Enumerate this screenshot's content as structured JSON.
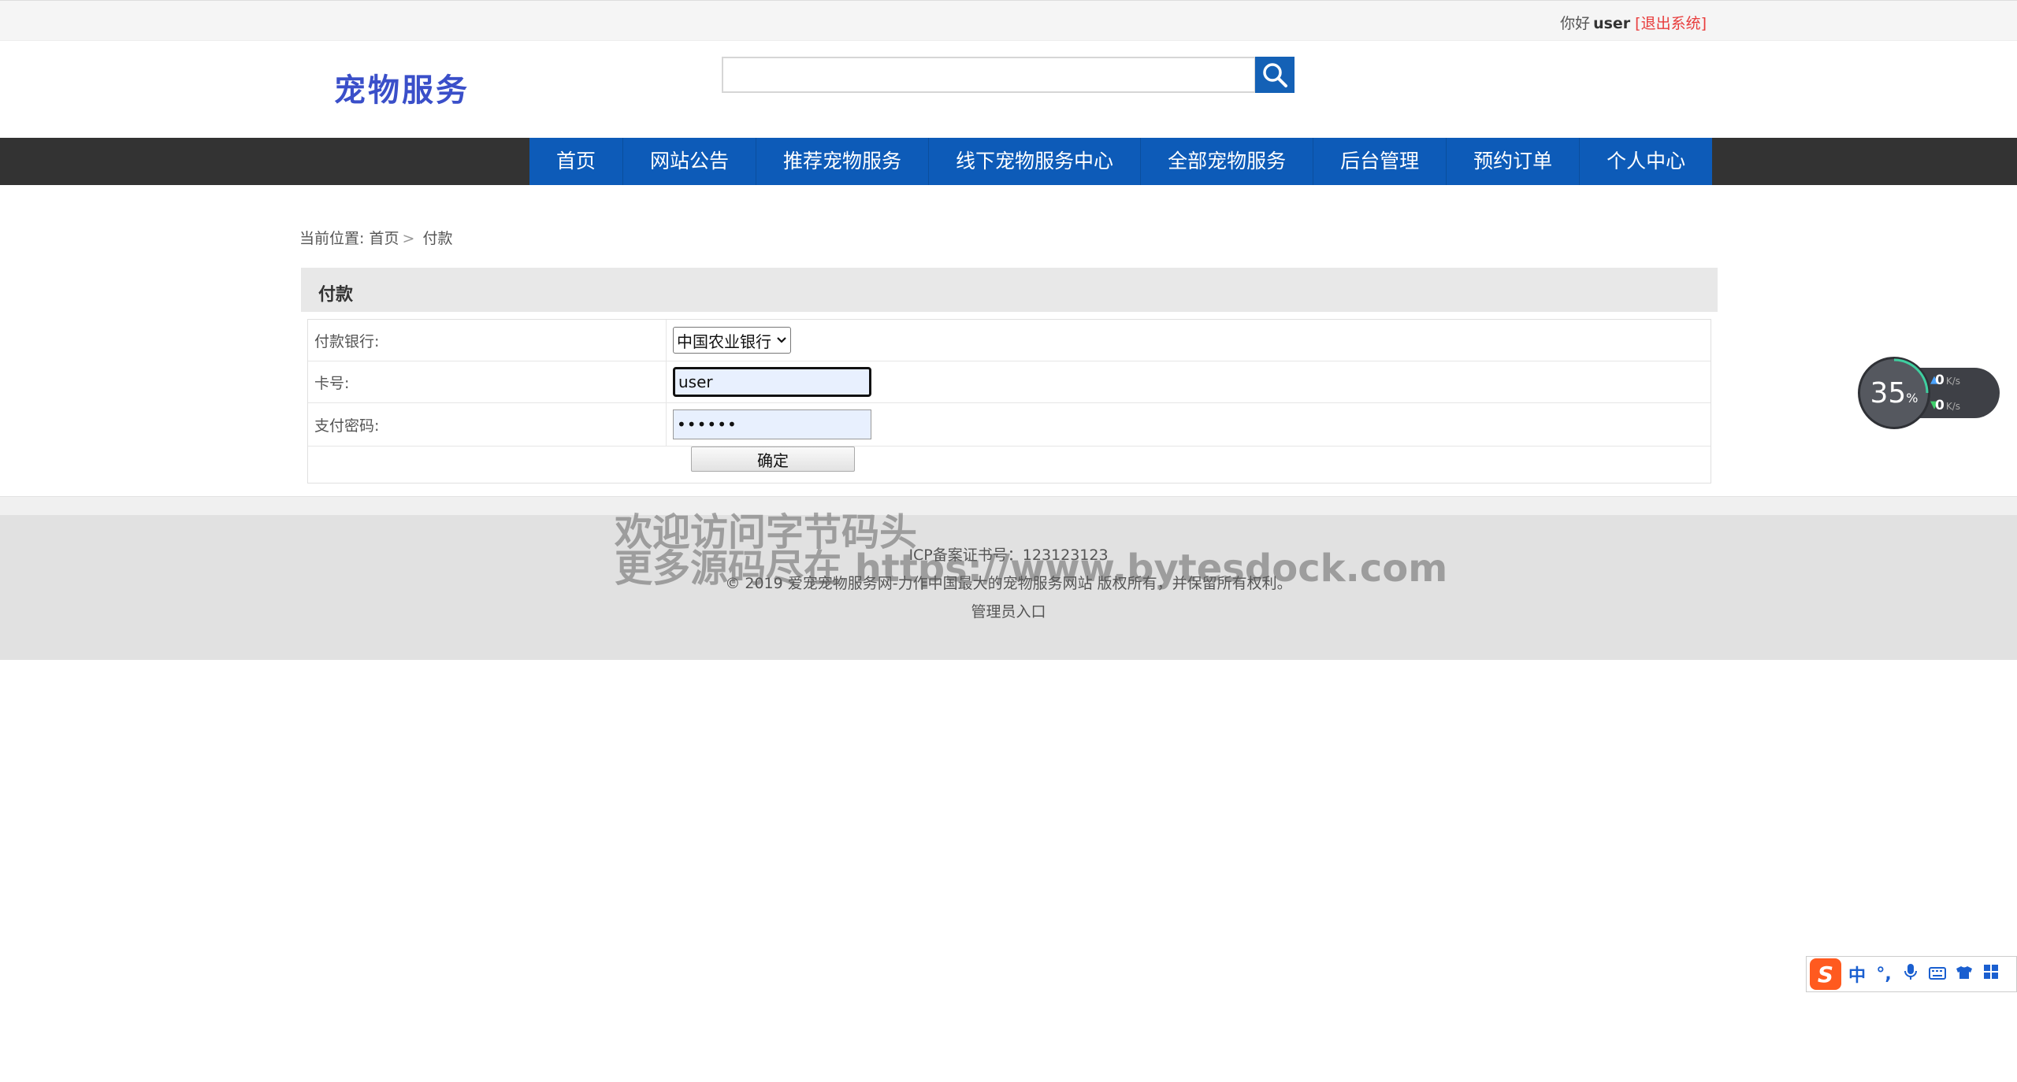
{
  "topbar": {
    "greeting": "你好",
    "username": "user",
    "logout": "[退出系统]"
  },
  "header": {
    "logo": "宠物服务",
    "search_value": ""
  },
  "nav": {
    "items": [
      {
        "label": "首页"
      },
      {
        "label": "网站公告"
      },
      {
        "label": "推荐宠物服务"
      },
      {
        "label": "线下宠物服务中心"
      },
      {
        "label": "全部宠物服务"
      },
      {
        "label": "后台管理"
      },
      {
        "label": "预约订单"
      },
      {
        "label": "个人中心"
      }
    ]
  },
  "breadcrumb": {
    "prefix": "当前位置:",
    "home": "首页",
    "sep": ">",
    "current": "付款"
  },
  "panel": {
    "title": "付款"
  },
  "form": {
    "bank_label": "付款银行:",
    "bank_value": "中国农业银行",
    "card_label": "卡号:",
    "card_value": "user",
    "password_label": "支付密码:",
    "password_mask": "••••••",
    "submit": "确定"
  },
  "footer": {
    "icp": "ICP备案证书号：123123123",
    "copyright": "© 2019 爱宠宠物服务网-力作中国最大的宠物服务网站 版权所有，并保留所有权利。",
    "admin_link": "管理员入口"
  },
  "watermark": {
    "line1": "欢迎访问字节码头",
    "line2": "更多源码尽在  https://www.bytesdock.com"
  },
  "speed_widget": {
    "percent": "35",
    "percent_unit": "%",
    "up_value": "0",
    "down_value": "0",
    "unit": "K/s"
  },
  "ime": {
    "logo": "S",
    "mode": "中",
    "punct": "°,",
    "icons": [
      "microphone-icon",
      "keyboard-icon",
      "skin-icon",
      "toolbox-icon"
    ]
  },
  "colors": {
    "nav_blue": "#0d5bb8",
    "nav_bar": "#333333",
    "logo": "#3a4fc9",
    "logout": "#e83c3c",
    "search_btn": "#1461b6"
  }
}
